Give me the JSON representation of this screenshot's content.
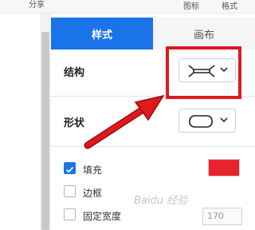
{
  "topbar": {
    "share": "分享",
    "icon": "图标",
    "format": "格式"
  },
  "tabs": {
    "style": "样式",
    "canvas": "画布"
  },
  "structure": {
    "label": "结构",
    "icon": "bracket-structure-icon"
  },
  "shape": {
    "label": "形状",
    "icon": "rounded-rectangle-icon"
  },
  "options": [
    {
      "label": "填充",
      "checked": true
    },
    {
      "label": "边框",
      "checked": false
    },
    {
      "label": "固定宽度",
      "checked": false
    }
  ],
  "fill_color": "#e8232e",
  "fixed_width_value": "170",
  "watermark": "Baidu 经验",
  "accent_color": "#1a73e8",
  "annotation_color": "#e0191f"
}
